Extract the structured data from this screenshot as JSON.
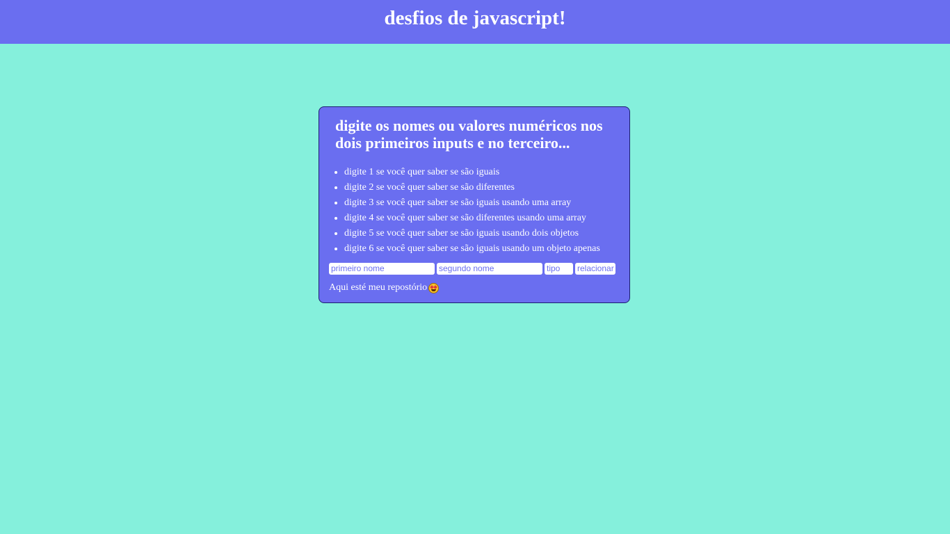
{
  "header": {
    "title": "desfios de javascript!"
  },
  "card": {
    "heading": "digite os nomes ou valores numéricos nos dois primeiros inputs e no terceiro...",
    "instructions": [
      "digite 1 se você quer saber se são iguais",
      "digite 2 se você quer saber se são diferentes",
      "digite 3 se você quer saber se são iguais usando uma array",
      "digite 4 se você quer saber se são diferentes usando uma array",
      "digite 5 se você quer saber se são iguais usando dois objetos",
      "digite 6 se você quer saber se são iguais usando um objeto apenas"
    ],
    "inputs": {
      "first_placeholder": "primeiro nome",
      "second_placeholder": "segundo nome",
      "type_placeholder": "tipo",
      "first_value": "",
      "second_value": "",
      "type_value": ""
    },
    "button_label": "relacionar",
    "repo_text": "Aqui esté meu repostório",
    "repo_icon": "star-struck-emoji-icon"
  },
  "colors": {
    "background": "#85f0dc",
    "accent": "#6a6ef0",
    "text": "#ffffff"
  }
}
